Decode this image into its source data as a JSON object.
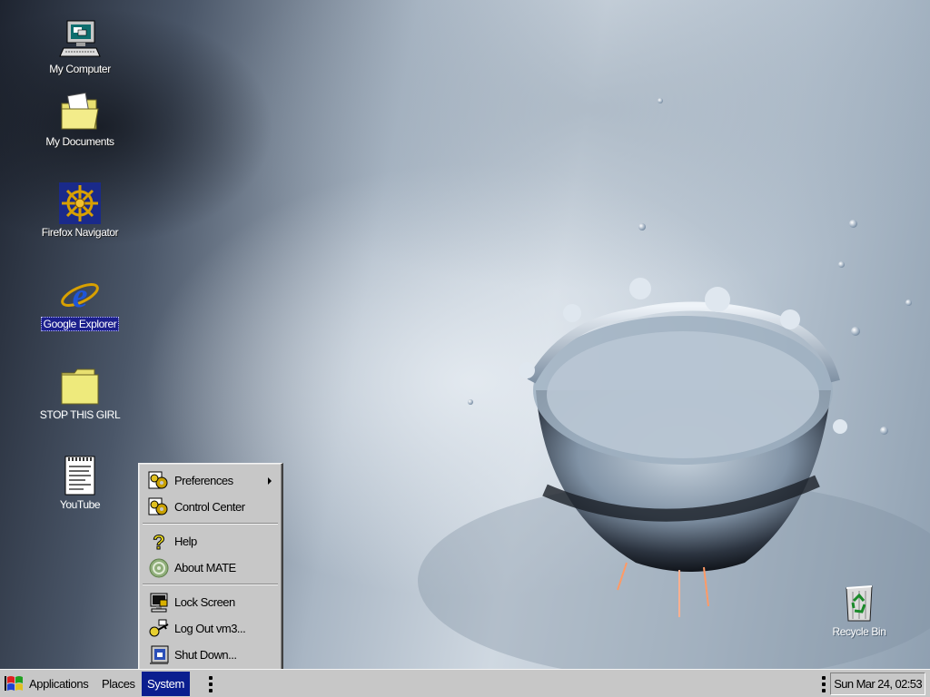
{
  "desktop": {
    "icons": [
      {
        "label": "My Computer",
        "icon": "computer-icon"
      },
      {
        "label": "My Documents",
        "icon": "documents-folder-icon"
      },
      {
        "label": "Firefox Navigator",
        "icon": "ship-wheel-icon"
      },
      {
        "label": "Google Explorer",
        "icon": "internet-explorer-icon",
        "selected": true
      },
      {
        "label": "STOP THIS GIRL",
        "icon": "folder-icon"
      },
      {
        "label": "YouTube",
        "icon": "text-document-icon"
      },
      {
        "label": "Recycle Bin",
        "icon": "recycle-bin-icon"
      }
    ]
  },
  "system_menu": {
    "items": [
      {
        "label": "Preferences",
        "icon": "preferences-gear-icon",
        "submenu": true
      },
      {
        "label": "Control Center",
        "icon": "control-center-gear-icon"
      },
      {
        "label": "Help",
        "icon": "help-question-icon"
      },
      {
        "label": "About MATE",
        "icon": "mate-logo-icon"
      },
      {
        "label": "Lock Screen",
        "icon": "lock-screen-icon"
      },
      {
        "label": "Log Out vm3...",
        "icon": "log-out-key-icon"
      },
      {
        "label": "Shut Down...",
        "icon": "shut-down-computer-icon"
      }
    ]
  },
  "taskbar": {
    "applications_label": "Applications",
    "places_label": "Places",
    "system_label": "System",
    "clock": "Sun Mar 24, 02:53"
  },
  "colors": {
    "menu_bg": "#c7c7c7",
    "selection": "#0b1e8f",
    "desktop_label_selected_bg": "#1b1f8c"
  }
}
